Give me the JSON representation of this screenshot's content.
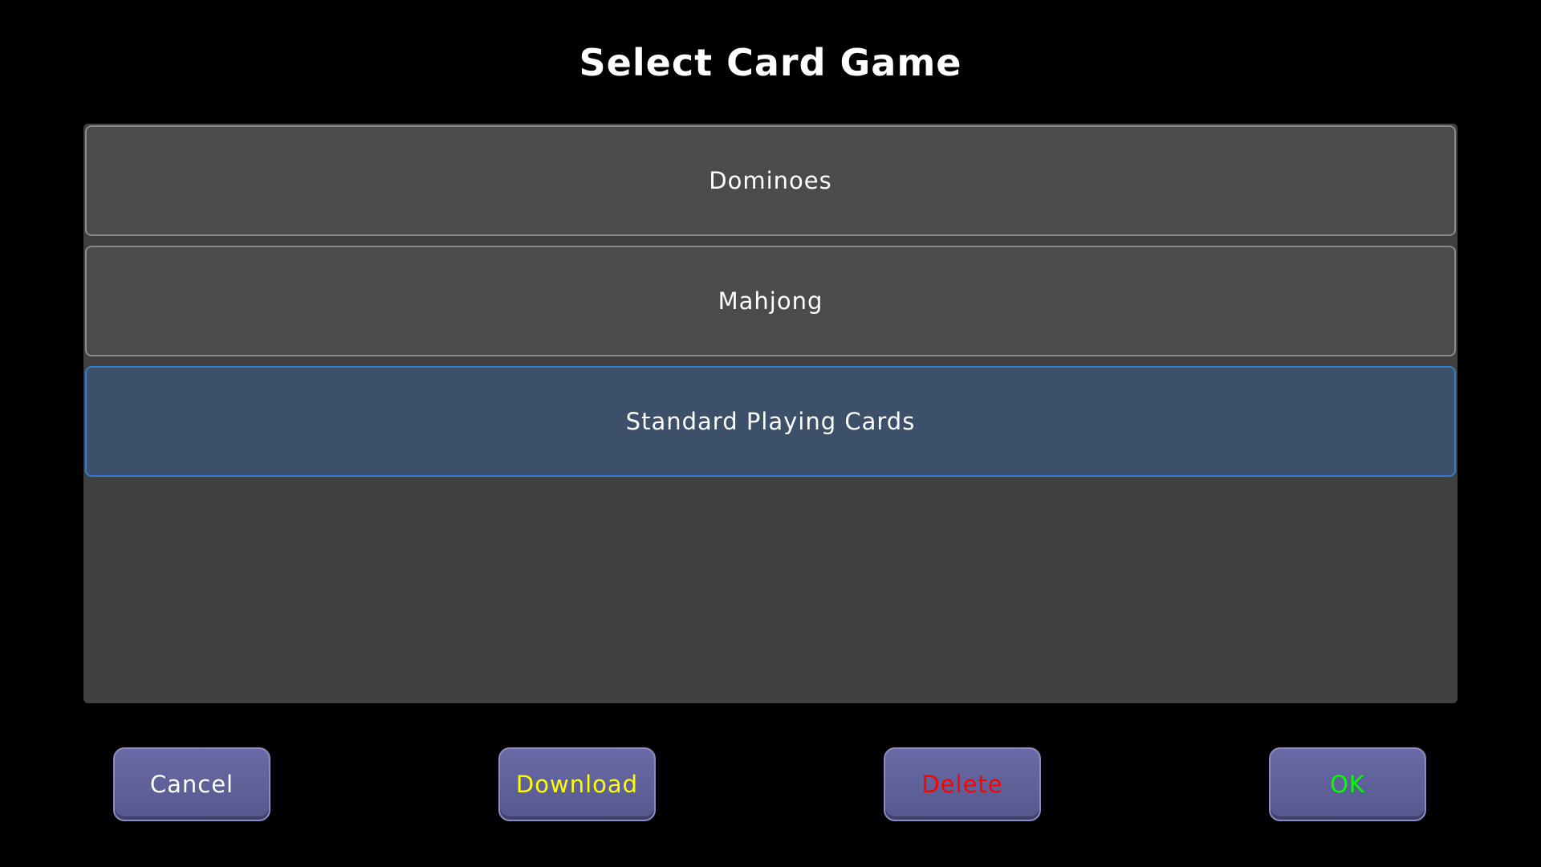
{
  "dialog": {
    "title": "Select Card Game"
  },
  "list": {
    "items": [
      {
        "label": "Dominoes",
        "selected": false
      },
      {
        "label": "Mahjong",
        "selected": false
      },
      {
        "label": "Standard Playing Cards",
        "selected": true
      }
    ]
  },
  "buttons": {
    "cancel": {
      "label": "Cancel",
      "color": "#ffffff"
    },
    "download": {
      "label": "Download",
      "color": "#ffff00"
    },
    "delete": {
      "label": "Delete",
      "color": "#ff0000"
    },
    "ok": {
      "label": "OK",
      "color": "#00ff00"
    }
  },
  "colors": {
    "background": "#000000",
    "panel": "#404040",
    "item": "#4b4b4b",
    "item_selected": "#3c5169",
    "item_selected_border": "#2f7fd6",
    "button_face": "#5f61a0"
  }
}
